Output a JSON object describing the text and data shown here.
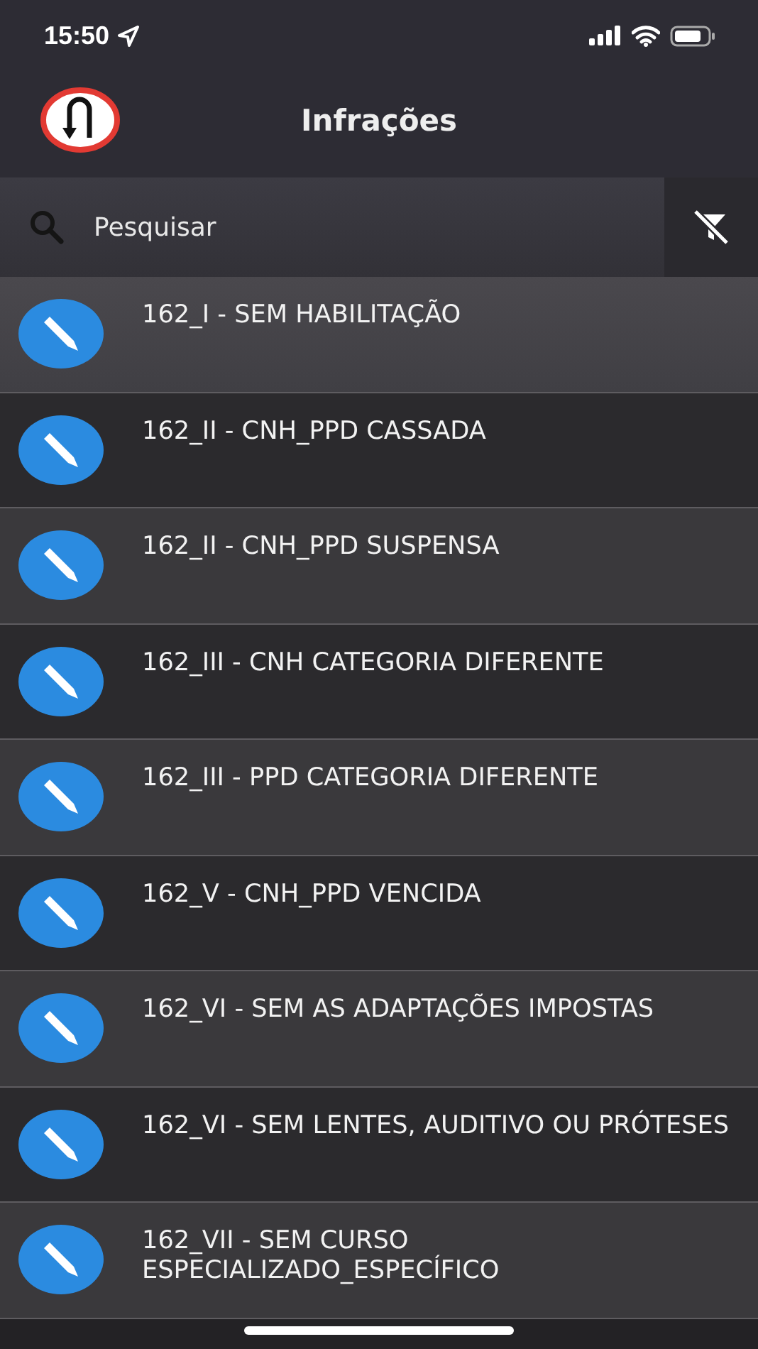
{
  "status_bar": {
    "time": "15:50"
  },
  "header": {
    "title": "Infrações"
  },
  "search": {
    "placeholder": "Pesquisar"
  },
  "infractions": [
    {
      "label": "162_I - SEM HABILITAÇÃO",
      "selected": true
    },
    {
      "label": "162_II - CNH_PPD CASSADA",
      "selected": false
    },
    {
      "label": "162_II - CNH_PPD SUSPENSA",
      "selected": false
    },
    {
      "label": "162_III - CNH CATEGORIA DIFERENTE",
      "selected": false
    },
    {
      "label": "162_III - PPD CATEGORIA DIFERENTE",
      "selected": false
    },
    {
      "label": "162_V - CNH_PPD VENCIDA",
      "selected": false
    },
    {
      "label": "162_VI - SEM AS ADAPTAÇÕES IMPOSTAS",
      "selected": false
    },
    {
      "label": "162_VI - SEM LENTES, AUDITIVO OU PRÓTESES",
      "selected": false
    },
    {
      "label": "162_VII - SEM CURSO ESPECIALIZADO_ESPECÍFICO",
      "selected": false
    }
  ]
}
